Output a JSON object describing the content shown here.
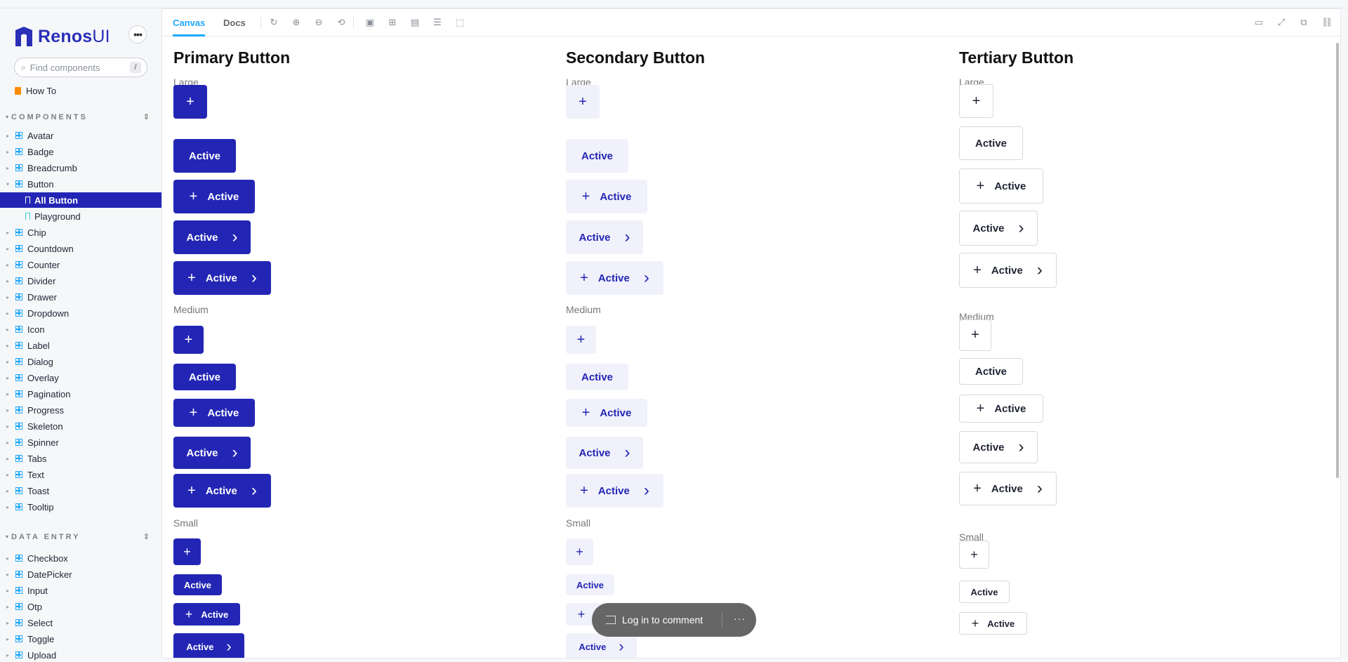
{
  "app": {
    "name_strong": "Renos",
    "name_light": "UI",
    "menu_icon": "ellipsis-icon"
  },
  "search": {
    "placeholder": "Find components",
    "shortcut": "/"
  },
  "sidebar": {
    "howto": "How To",
    "components_title": "COMPONENTS",
    "components": [
      "Avatar",
      "Badge",
      "Breadcrumb",
      "Button",
      "Chip",
      "Countdown",
      "Counter",
      "Divider",
      "Drawer",
      "Dropdown",
      "Icon",
      "Label",
      "Dialog",
      "Overlay",
      "Pagination",
      "Progress",
      "Skeleton",
      "Spinner",
      "Tabs",
      "Text",
      "Toast",
      "Tooltip"
    ],
    "button_stories": [
      "All Button",
      "Playground"
    ],
    "selected_story": "All Button",
    "data_entry_title": "DATA ENTRY",
    "data_entry": [
      "Checkbox",
      "DatePicker",
      "Input",
      "Otp",
      "Select",
      "Toggle",
      "Upload"
    ]
  },
  "toolbar": {
    "tabs": [
      "Canvas",
      "Docs"
    ],
    "active_tab": "Canvas"
  },
  "columns": {
    "primary": {
      "title": "Primary Button"
    },
    "secondary": {
      "title": "Secondary Button"
    },
    "tertiary": {
      "title": "Tertiary Button"
    }
  },
  "sizes": {
    "large": "Large",
    "medium": "Medium",
    "small": "Small"
  },
  "button_label": "Active",
  "plus_glyph": "+",
  "chevron_glyph": "›",
  "comment": {
    "label": "Log in to comment",
    "more": "···"
  },
  "colors": {
    "primary": "#2326b4",
    "secondary_bg": "#f0f1fb",
    "accent": "#1ea7fd"
  }
}
